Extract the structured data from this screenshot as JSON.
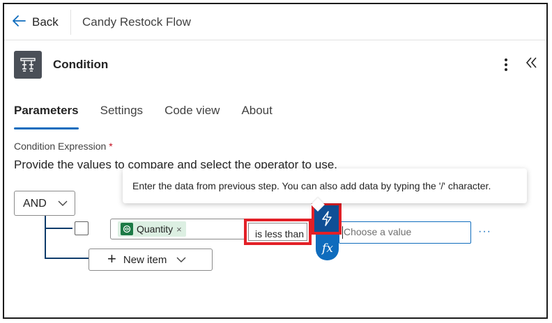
{
  "topbar": {
    "back_label": "Back",
    "flow_title": "Candy Restock Flow"
  },
  "header": {
    "title": "Condition",
    "icon": "condition-icon",
    "more_icon": "more-vertical-icon",
    "collapse_icon": "chevron-double-left-icon"
  },
  "tabs": [
    {
      "label": "Parameters",
      "active": true
    },
    {
      "label": "Settings",
      "active": false
    },
    {
      "label": "Code view",
      "active": false
    },
    {
      "label": "About",
      "active": false
    }
  ],
  "condition": {
    "label": "Condition Expression",
    "required_mark": "*",
    "description": "Provide the values to compare and select the operator to use.",
    "group_operator": "AND",
    "row": {
      "left_token": "Quantity",
      "left_token_remove": "×",
      "operator": "is less than",
      "right_placeholder": "Choose a value",
      "more": "···"
    },
    "new_item_label": "New item"
  },
  "tooltip": {
    "text": "Enter the data from previous step. You can also add data by typing the '/' character."
  },
  "colors": {
    "accent": "#0f6cbd",
    "highlight": "#e32027",
    "token_bg": "#dcefe2",
    "token_icon": "#1d7a46"
  }
}
